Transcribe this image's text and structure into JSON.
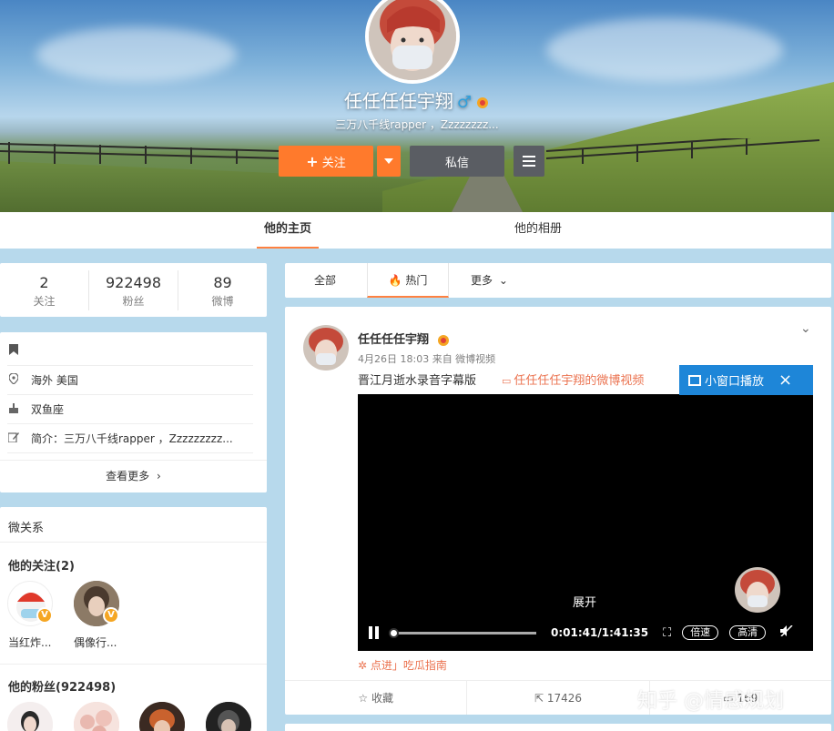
{
  "profile": {
    "name": "任任任任宇翔",
    "gender_symbol": "♂",
    "bio": "三万八千线rapper ，Zzzzzzzz...",
    "follow_label": "关注",
    "message_label": "私信"
  },
  "tabs": [
    {
      "label": "他的主页",
      "active": true
    },
    {
      "label": "他的相册",
      "active": false
    }
  ],
  "stats": [
    {
      "value": "2",
      "label": "关注"
    },
    {
      "value": "922498",
      "label": "粉丝"
    },
    {
      "value": "89",
      "label": "微博"
    }
  ],
  "info": {
    "location": "海外 美国",
    "zodiac": "双鱼座",
    "intro": "简介：三万八千线rapper ，Zzzzzzzzz...",
    "more_label": "查看更多"
  },
  "relations": {
    "title": "微关系",
    "following_title": "他的关注(2)",
    "following": [
      {
        "name": "当红炸..."
      },
      {
        "name": "偶像行..."
      }
    ],
    "fans_title": "他的粉丝(922498)"
  },
  "feed_tabs": [
    "全部",
    "热门",
    "更多"
  ],
  "post": {
    "author": "任任任任宇翔",
    "meta": "4月26日 18:03 来自 微博视频",
    "text": "晋江月逝水录音字幕版",
    "video_link": "任任任任宇翔的微博视频",
    "expand_label": "展开",
    "time": "0:01:41/1:41:35",
    "speed_label": "倍速",
    "quality_label": "高清",
    "tip": "点进」吃瓜指南",
    "actions": [
      {
        "label": "收藏"
      },
      {
        "label": "17426"
      },
      {
        "label": "169"
      }
    ]
  },
  "popup": {
    "label": "小窗口播放"
  },
  "watermark": "知乎 @情感规划",
  "colors": {
    "accent": "#ff8140",
    "follow_button": "#ff7a2c",
    "link": "#eb7350",
    "popup": "#1e86d8"
  }
}
